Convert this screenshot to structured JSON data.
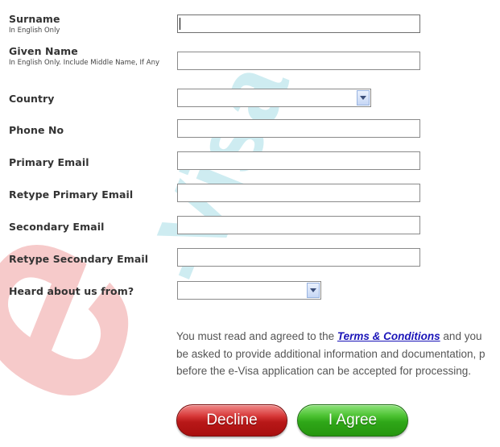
{
  "watermark": {
    "text": "e-Visa",
    "prefix": "e",
    "suffix": "-Visa",
    "prefix_color": "#e23030",
    "suffix_color": "#3fa8bb"
  },
  "fields": {
    "surname": {
      "label": "Surname",
      "hint": "In English Only",
      "value": ""
    },
    "given_name": {
      "label": "Given Name",
      "hint": "In English Only. Include Middle Name, If Any",
      "value": ""
    },
    "country": {
      "label": "Country",
      "selected": ""
    },
    "phone": {
      "label": "Phone No",
      "value": ""
    },
    "primary_email": {
      "label": "Primary Email",
      "value": ""
    },
    "retype_primary_email": {
      "label": "Retype Primary Email",
      "value": ""
    },
    "secondary_email": {
      "label": "Secondary Email",
      "value": ""
    },
    "retype_secondary_email": {
      "label": "Retype Secondary Email",
      "value": ""
    },
    "heard_about": {
      "label": "Heard about us from?",
      "selected": ""
    }
  },
  "notice": {
    "line1_before": "You must read and agreed to the ",
    "link_text": "Terms & Conditions",
    "line1_after": " and you",
    "line2": "be asked to provide additional information and documentation, p",
    "line3": "before the e-Visa application can be accepted for processing."
  },
  "buttons": {
    "decline": "Decline",
    "agree": "I Agree"
  },
  "colors": {
    "link": "#1a14b8",
    "decline": "#c21d1d",
    "agree": "#34ad1c",
    "select_arrow": "#c6d7f5"
  }
}
